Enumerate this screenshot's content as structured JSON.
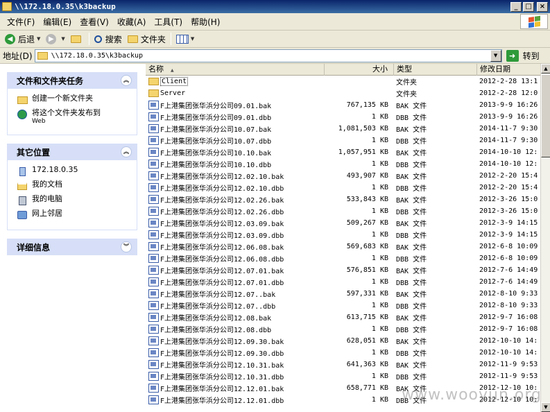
{
  "window": {
    "title": "\\\\172.18.0.35\\k3backup",
    "app_icon": "folder-icon",
    "controls": [
      "minimize-icon",
      "maximize-icon",
      "close-icon"
    ]
  },
  "menu": {
    "items": [
      "文件(F)",
      "编辑(E)",
      "查看(V)",
      "收藏(A)",
      "工具(T)",
      "帮助(H)"
    ]
  },
  "toolbar": {
    "back_label": "后退",
    "search_label": "搜索",
    "folders_label": "文件夹"
  },
  "address": {
    "label": "地址(D)",
    "value": "\\\\172.18.0.35\\k3backup",
    "go_label": "转到"
  },
  "tasks": {
    "file_tasks": {
      "title": "文件和文件夹任务",
      "items": [
        {
          "label": "创建一个新文件夹",
          "sub": "",
          "icon": "new-folder-icon"
        },
        {
          "label": "将这个文件夹发布到",
          "sub": "Web",
          "icon": "globe-icon"
        }
      ]
    },
    "other_places": {
      "title": "其它位置",
      "items": [
        {
          "label": "172.18.0.35",
          "icon": "network-share-icon"
        },
        {
          "label": "我的文档",
          "icon": "my-documents-icon"
        },
        {
          "label": "我的电脑",
          "icon": "my-computer-icon"
        },
        {
          "label": "网上邻居",
          "icon": "network-places-icon"
        }
      ]
    },
    "details": {
      "title": "详细信息"
    }
  },
  "filelist": {
    "columns": [
      "名称",
      "大小",
      "类型",
      "修改日期"
    ],
    "rows": [
      {
        "name": "Client",
        "size": "",
        "type": "文件夹",
        "date": "2012-2-28 13:1",
        "kind": "folder",
        "selected": true
      },
      {
        "name": "Server",
        "size": "",
        "type": "文件夹",
        "date": "2012-2-28 12:0",
        "kind": "folder"
      },
      {
        "name": "F上港集团张华浜分公司09.01.bak",
        "size": "767,135 KB",
        "type": "BAK 文件",
        "date": "2013-9-9 16:26",
        "kind": "file"
      },
      {
        "name": "F上港集团张华浜分公司09.01.dbb",
        "size": "1 KB",
        "type": "DBB 文件",
        "date": "2013-9-9 16:26",
        "kind": "file"
      },
      {
        "name": "F上港集团张华浜分公司10.07.bak",
        "size": "1,081,503 KB",
        "type": "BAK 文件",
        "date": "2014-11-7 9:30",
        "kind": "file"
      },
      {
        "name": "F上港集团张华浜分公司10.07.dbb",
        "size": "1 KB",
        "type": "DBB 文件",
        "date": "2014-11-7 9:30",
        "kind": "file"
      },
      {
        "name": "F上港集团张华浜分公司10.10.bak",
        "size": "1,057,951 KB",
        "type": "BAK 文件",
        "date": "2014-10-10 12:",
        "kind": "file"
      },
      {
        "name": "F上港集团张华浜分公司10.10.dbb",
        "size": "1 KB",
        "type": "DBB 文件",
        "date": "2014-10-10 12:",
        "kind": "file"
      },
      {
        "name": "F上港集团张华浜分公司12.02.10.bak",
        "size": "493,907 KB",
        "type": "BAK 文件",
        "date": "2012-2-20 15:4",
        "kind": "file"
      },
      {
        "name": "F上港集团张华浜分公司12.02.10.dbb",
        "size": "1 KB",
        "type": "DBB 文件",
        "date": "2012-2-20 15:4",
        "kind": "file"
      },
      {
        "name": "F上港集团张华浜分公司12.02.26.bak",
        "size": "533,843 KB",
        "type": "BAK 文件",
        "date": "2012-3-26 15:0",
        "kind": "file"
      },
      {
        "name": "F上港集团张华浜分公司12.02.26.dbb",
        "size": "1 KB",
        "type": "DBB 文件",
        "date": "2012-3-26 15:0",
        "kind": "file"
      },
      {
        "name": "F上港集团张华浜分公司12.03.09.bak",
        "size": "509,267 KB",
        "type": "BAK 文件",
        "date": "2012-3-9 14:15",
        "kind": "file"
      },
      {
        "name": "F上港集团张华浜分公司12.03.09.dbb",
        "size": "1 KB",
        "type": "DBB 文件",
        "date": "2012-3-9 14:15",
        "kind": "file"
      },
      {
        "name": "F上港集团张华浜分公司12.06.08.bak",
        "size": "569,683 KB",
        "type": "BAK 文件",
        "date": "2012-6-8 10:09",
        "kind": "file"
      },
      {
        "name": "F上港集团张华浜分公司12.06.08.dbb",
        "size": "1 KB",
        "type": "DBB 文件",
        "date": "2012-6-8 10:09",
        "kind": "file"
      },
      {
        "name": "F上港集团张华浜分公司12.07.01.bak",
        "size": "576,851 KB",
        "type": "BAK 文件",
        "date": "2012-7-6 14:49",
        "kind": "file"
      },
      {
        "name": "F上港集团张华浜分公司12.07.01.dbb",
        "size": "1 KB",
        "type": "DBB 文件",
        "date": "2012-7-6 14:49",
        "kind": "file"
      },
      {
        "name": "F上港集团张华浜分公司12.07..bak",
        "size": "597,331 KB",
        "type": "BAK 文件",
        "date": "2012-8-10 9:33",
        "kind": "file"
      },
      {
        "name": "F上港集团张华浜分公司12.07..dbb",
        "size": "1 KB",
        "type": "DBB 文件",
        "date": "2012-8-10 9:33",
        "kind": "file"
      },
      {
        "name": "F上港集团张华浜分公司12.08.bak",
        "size": "613,715 KB",
        "type": "BAK 文件",
        "date": "2012-9-7 16:08",
        "kind": "file"
      },
      {
        "name": "F上港集团张华浜分公司12.08.dbb",
        "size": "1 KB",
        "type": "DBB 文件",
        "date": "2012-9-7 16:08",
        "kind": "file"
      },
      {
        "name": "F上港集团张华浜分公司12.09.30.bak",
        "size": "628,051 KB",
        "type": "BAK 文件",
        "date": "2012-10-10 14:",
        "kind": "file"
      },
      {
        "name": "F上港集团张华浜分公司12.09.30.dbb",
        "size": "1 KB",
        "type": "DBB 文件",
        "date": "2012-10-10 14:",
        "kind": "file"
      },
      {
        "name": "F上港集团张华浜分公司12.10.31.bak",
        "size": "641,363 KB",
        "type": "BAK 文件",
        "date": "2012-11-9 9:53",
        "kind": "file"
      },
      {
        "name": "F上港集团张华浜分公司12.10.31.dbb",
        "size": "1 KB",
        "type": "DBB 文件",
        "date": "2012-11-9 9:53",
        "kind": "file"
      },
      {
        "name": "F上港集团张华浜分公司12.12.01.bak",
        "size": "658,771 KB",
        "type": "BAK 文件",
        "date": "2012-12-10 10:",
        "kind": "file"
      },
      {
        "name": "F上港集团张华浜分公司12.12.01.dbb",
        "size": "1 KB",
        "type": "DBB 文件",
        "date": "2012-12-10 10:",
        "kind": "file"
      }
    ]
  },
  "watermark": "www.wooyun.org",
  "colors": {
    "title_bar": "#0a246a",
    "task_header": "#d6dff7",
    "go_green": "#2e9a3a"
  }
}
